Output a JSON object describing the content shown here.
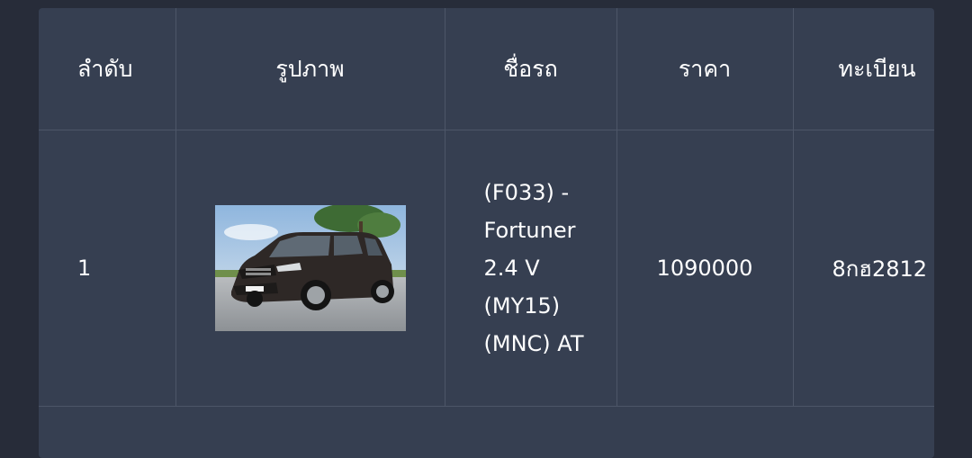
{
  "table": {
    "headers": {
      "index": "ลำดับ",
      "image": "รูปภาพ",
      "name": "ชื่อรถ",
      "price": "ราคา",
      "plate": "ทะเบียน"
    },
    "rows": [
      {
        "index": "1",
        "image_icon": "car-photo",
        "name": "(F033) - Fortuner 2.4 V (MY15) (MNC) AT",
        "price": "1090000",
        "plate": "8กฮ2812"
      }
    ]
  },
  "colors": {
    "page_background": "#272c39",
    "panel_background": "#363f51",
    "grid_line": "#4d5668",
    "text": "#ffffff"
  }
}
